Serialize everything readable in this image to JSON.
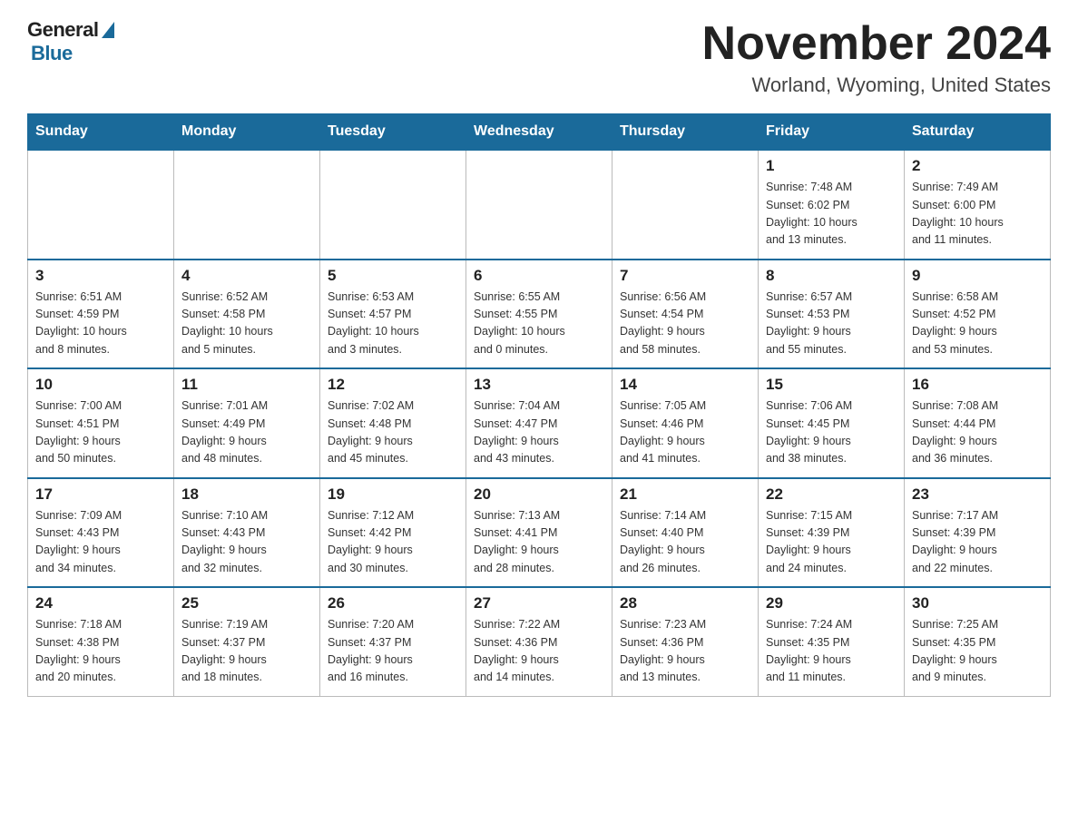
{
  "logo": {
    "general": "General",
    "blue": "Blue"
  },
  "title": "November 2024",
  "location": "Worland, Wyoming, United States",
  "days_of_week": [
    "Sunday",
    "Monday",
    "Tuesday",
    "Wednesday",
    "Thursday",
    "Friday",
    "Saturday"
  ],
  "weeks": [
    [
      {
        "day": "",
        "info": ""
      },
      {
        "day": "",
        "info": ""
      },
      {
        "day": "",
        "info": ""
      },
      {
        "day": "",
        "info": ""
      },
      {
        "day": "",
        "info": ""
      },
      {
        "day": "1",
        "info": "Sunrise: 7:48 AM\nSunset: 6:02 PM\nDaylight: 10 hours\nand 13 minutes."
      },
      {
        "day": "2",
        "info": "Sunrise: 7:49 AM\nSunset: 6:00 PM\nDaylight: 10 hours\nand 11 minutes."
      }
    ],
    [
      {
        "day": "3",
        "info": "Sunrise: 6:51 AM\nSunset: 4:59 PM\nDaylight: 10 hours\nand 8 minutes."
      },
      {
        "day": "4",
        "info": "Sunrise: 6:52 AM\nSunset: 4:58 PM\nDaylight: 10 hours\nand 5 minutes."
      },
      {
        "day": "5",
        "info": "Sunrise: 6:53 AM\nSunset: 4:57 PM\nDaylight: 10 hours\nand 3 minutes."
      },
      {
        "day": "6",
        "info": "Sunrise: 6:55 AM\nSunset: 4:55 PM\nDaylight: 10 hours\nand 0 minutes."
      },
      {
        "day": "7",
        "info": "Sunrise: 6:56 AM\nSunset: 4:54 PM\nDaylight: 9 hours\nand 58 minutes."
      },
      {
        "day": "8",
        "info": "Sunrise: 6:57 AM\nSunset: 4:53 PM\nDaylight: 9 hours\nand 55 minutes."
      },
      {
        "day": "9",
        "info": "Sunrise: 6:58 AM\nSunset: 4:52 PM\nDaylight: 9 hours\nand 53 minutes."
      }
    ],
    [
      {
        "day": "10",
        "info": "Sunrise: 7:00 AM\nSunset: 4:51 PM\nDaylight: 9 hours\nand 50 minutes."
      },
      {
        "day": "11",
        "info": "Sunrise: 7:01 AM\nSunset: 4:49 PM\nDaylight: 9 hours\nand 48 minutes."
      },
      {
        "day": "12",
        "info": "Sunrise: 7:02 AM\nSunset: 4:48 PM\nDaylight: 9 hours\nand 45 minutes."
      },
      {
        "day": "13",
        "info": "Sunrise: 7:04 AM\nSunset: 4:47 PM\nDaylight: 9 hours\nand 43 minutes."
      },
      {
        "day": "14",
        "info": "Sunrise: 7:05 AM\nSunset: 4:46 PM\nDaylight: 9 hours\nand 41 minutes."
      },
      {
        "day": "15",
        "info": "Sunrise: 7:06 AM\nSunset: 4:45 PM\nDaylight: 9 hours\nand 38 minutes."
      },
      {
        "day": "16",
        "info": "Sunrise: 7:08 AM\nSunset: 4:44 PM\nDaylight: 9 hours\nand 36 minutes."
      }
    ],
    [
      {
        "day": "17",
        "info": "Sunrise: 7:09 AM\nSunset: 4:43 PM\nDaylight: 9 hours\nand 34 minutes."
      },
      {
        "day": "18",
        "info": "Sunrise: 7:10 AM\nSunset: 4:43 PM\nDaylight: 9 hours\nand 32 minutes."
      },
      {
        "day": "19",
        "info": "Sunrise: 7:12 AM\nSunset: 4:42 PM\nDaylight: 9 hours\nand 30 minutes."
      },
      {
        "day": "20",
        "info": "Sunrise: 7:13 AM\nSunset: 4:41 PM\nDaylight: 9 hours\nand 28 minutes."
      },
      {
        "day": "21",
        "info": "Sunrise: 7:14 AM\nSunset: 4:40 PM\nDaylight: 9 hours\nand 26 minutes."
      },
      {
        "day": "22",
        "info": "Sunrise: 7:15 AM\nSunset: 4:39 PM\nDaylight: 9 hours\nand 24 minutes."
      },
      {
        "day": "23",
        "info": "Sunrise: 7:17 AM\nSunset: 4:39 PM\nDaylight: 9 hours\nand 22 minutes."
      }
    ],
    [
      {
        "day": "24",
        "info": "Sunrise: 7:18 AM\nSunset: 4:38 PM\nDaylight: 9 hours\nand 20 minutes."
      },
      {
        "day": "25",
        "info": "Sunrise: 7:19 AM\nSunset: 4:37 PM\nDaylight: 9 hours\nand 18 minutes."
      },
      {
        "day": "26",
        "info": "Sunrise: 7:20 AM\nSunset: 4:37 PM\nDaylight: 9 hours\nand 16 minutes."
      },
      {
        "day": "27",
        "info": "Sunrise: 7:22 AM\nSunset: 4:36 PM\nDaylight: 9 hours\nand 14 minutes."
      },
      {
        "day": "28",
        "info": "Sunrise: 7:23 AM\nSunset: 4:36 PM\nDaylight: 9 hours\nand 13 minutes."
      },
      {
        "day": "29",
        "info": "Sunrise: 7:24 AM\nSunset: 4:35 PM\nDaylight: 9 hours\nand 11 minutes."
      },
      {
        "day": "30",
        "info": "Sunrise: 7:25 AM\nSunset: 4:35 PM\nDaylight: 9 hours\nand 9 minutes."
      }
    ]
  ]
}
